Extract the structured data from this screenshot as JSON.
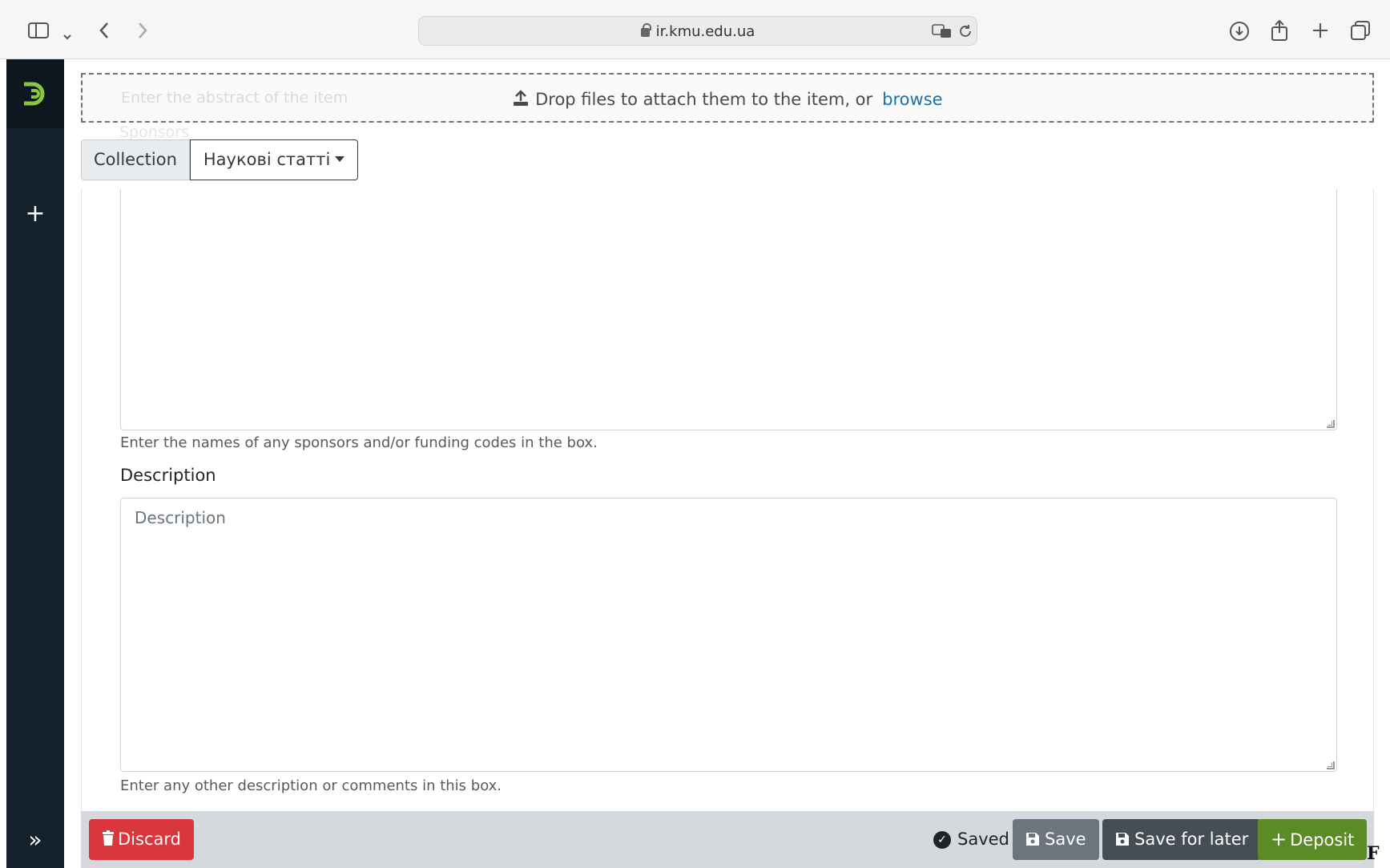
{
  "browser": {
    "url": "ir.kmu.edu.ua"
  },
  "sidebar": {
    "add_label": "+",
    "expand_label": "»"
  },
  "upload": {
    "ghost_text": "Enter the abstract of the item",
    "drop_text": "Drop files to attach them to the item, or",
    "browse_label": "browse"
  },
  "ghost_sponsors_label": "Sponsors",
  "collection": {
    "label": "Collection",
    "selected": "Наукові статті"
  },
  "sponsors": {
    "help": "Enter the names of any sponsors and/or funding codes in the box."
  },
  "description": {
    "label": "Description",
    "placeholder": "Description",
    "help": "Enter any other description or comments in this box."
  },
  "actions": {
    "discard_label": "Discard",
    "saved_label": "Saved",
    "save_label": "Save",
    "save_later_label": "Save for later",
    "deposit_label": "Deposit"
  },
  "corner_mark": "F",
  "colors": {
    "sidebar": "#14202c",
    "brand_green": "#8cc63f",
    "discard": "#d9363e",
    "deposit": "#5b8a26",
    "link": "#1c72a8"
  }
}
